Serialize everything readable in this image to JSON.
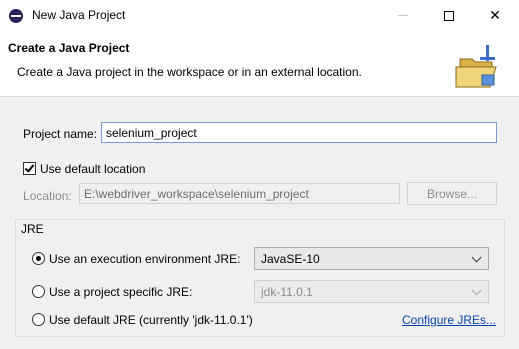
{
  "window": {
    "title": "New Java Project",
    "minimize_label": "",
    "maximize_label": "",
    "close_label": "✕"
  },
  "banner": {
    "title": "Create a Java Project",
    "description": "Create a Java project in the workspace or in an external location."
  },
  "project": {
    "name_label": "Project name:",
    "name_value": "selenium_project",
    "use_default_location_label": "Use default location",
    "use_default_location_checked": true,
    "location_label": "Location:",
    "location_value": "E:\\webdriver_workspace\\selenium_project",
    "browse_label": "Browse..."
  },
  "jre": {
    "group_label": "JRE",
    "options": [
      {
        "label": "Use an execution environment JRE:",
        "selected": true,
        "combo_value": "JavaSE-10",
        "combo_enabled": true
      },
      {
        "label": "Use a project specific JRE:",
        "selected": false,
        "combo_value": "jdk-11.0.1",
        "combo_enabled": false
      },
      {
        "label": "Use default JRE (currently 'jdk-11.0.1')",
        "selected": false
      }
    ],
    "configure_link": "Configure JREs..."
  }
}
